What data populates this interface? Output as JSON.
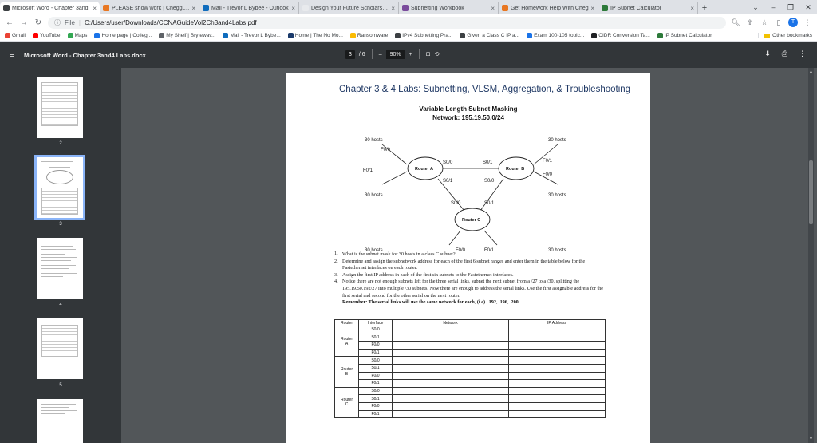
{
  "browser": {
    "tabs": [
      {
        "title": "Microsoft Word - Chapter 3and",
        "color": "#3c4043",
        "close": "×",
        "active": true
      },
      {
        "title": "PLEASE show work | Chegg.com",
        "color": "#e87722",
        "close": "×"
      },
      {
        "title": "Mail - Trevor L Bybee - Outlook",
        "color": "#0f6cbd",
        "close": "×"
      },
      {
        "title": "Design Your Future Scholarship",
        "color": "#e8eaed",
        "close": "×"
      },
      {
        "title": "Subnetting Workbook",
        "color": "#7a4b9c",
        "close": "×"
      },
      {
        "title": "Get Homework Help With Cheg",
        "color": "#e87722",
        "close": "×"
      },
      {
        "title": "IP Subnet Calculator",
        "color": "#2d7a3a",
        "close": "×"
      }
    ],
    "new_tab": "+",
    "window_controls": [
      "⌄",
      "–",
      "❐",
      "✕"
    ],
    "file_label": "File",
    "separator": "|",
    "url": "C:/Users/user/Downloads/CCNAGuideVol2Ch3and4Labs.pdf",
    "profile_initial": "T",
    "bookmarks": [
      {
        "label": "Gmail",
        "color": "#ea4335"
      },
      {
        "label": "YouTube",
        "color": "#ff0000"
      },
      {
        "label": "Maps",
        "color": "#34a853"
      },
      {
        "label": "Home page | Colleg...",
        "color": "#1a73e8"
      },
      {
        "label": "My Shelf | Brytewav...",
        "color": "#5f6368"
      },
      {
        "label": "Mail - Trevor L Bybe...",
        "color": "#0f6cbd"
      },
      {
        "label": "Home | The No Mo...",
        "color": "#1b3a6b"
      },
      {
        "label": "Ransomware",
        "color": "#fbbc04"
      },
      {
        "label": "IPv4 Subnetting Pra...",
        "color": "#3c4043"
      },
      {
        "label": "Given a Class C IP a...",
        "color": "#3c4043"
      },
      {
        "label": "Exam 100-105 topic...",
        "color": "#1a73e8"
      },
      {
        "label": "CIDR Conversion Ta...",
        "color": "#202124"
      },
      {
        "label": "IP Subnet Calculator",
        "color": "#2d7a3a"
      }
    ],
    "other_bookmarks": "Other bookmarks"
  },
  "pdf_toolbar": {
    "title": "Microsoft Word - Chapter 3and4 Labs.docx",
    "page_current": "3",
    "page_total": "/ 6",
    "zoom": "90%",
    "minus": "–",
    "plus": "+"
  },
  "sidebar": {
    "page_numbers": [
      "2",
      "3",
      "4",
      "5"
    ]
  },
  "document": {
    "heading": "Chapter 3 & 4 Labs: Subnetting, VLSM, Aggregation, & Troubleshooting",
    "vlsm_title": "Variable Length Subnet Masking",
    "network": "Network: 195.19.50.0/24",
    "diagram": {
      "hosts_label": "30 hosts",
      "router_a": "Router A",
      "router_b": "Router B",
      "router_c": "Router C",
      "f00": "F0/0",
      "f01": "F0/1",
      "s00": "S0/0",
      "s01": "S0/1"
    },
    "questions": [
      {
        "n": "1.",
        "text": "What is the subnet mask for 30 hosts in a class C subnet?"
      },
      {
        "n": "2.",
        "text": "Determine and assign the subnetwork address for each of the first 6 subnet ranges and enter them in the table below for the Fastethernet interfaces on each router."
      },
      {
        "n": "3.",
        "text": "Assign the first IP address in each of the first six subnets to the Fastethernet interfaces."
      },
      {
        "n": "4.",
        "text": "Notice there are not enough subnets left for the three serial links, subnet the next subnet from a /27 to a /30, splitting the 195.19.50.192/27 into multiple /30 subnets. Now there are enough to address the serial links. Use the first assignable address for the first serial and second for the other serial on the next router."
      }
    ],
    "remember": "Remember: The serial links will use the same network for each, (i.e). .192, .196, .200",
    "table": {
      "headers": [
        "Router",
        "Interface",
        "Network",
        "IP Address"
      ],
      "routers": [
        {
          "line1": "Router",
          "line2": "A",
          "interfaces": [
            "S0/0",
            "S0/1",
            "F0/0",
            "F0/1"
          ]
        },
        {
          "line1": "Router",
          "line2": "B",
          "interfaces": [
            "S0/0",
            "S0/1",
            "F0/0",
            "F0/1"
          ]
        },
        {
          "line1": "Router",
          "line2": "C",
          "interfaces": [
            "S0/0",
            "S0/1",
            "F0/0",
            "F0/1"
          ]
        }
      ]
    }
  }
}
